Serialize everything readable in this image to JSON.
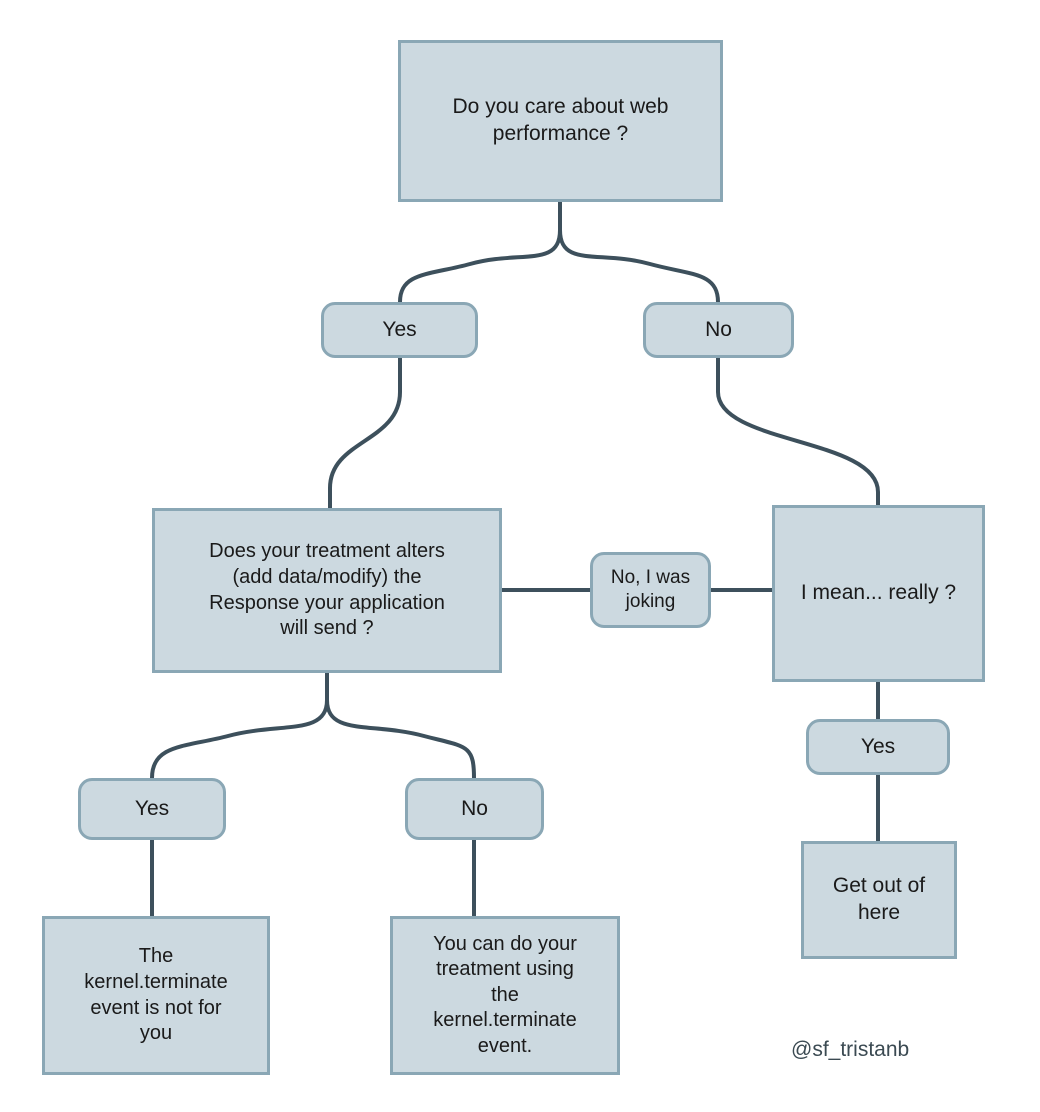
{
  "diagram": {
    "title": "kernel.terminate decision flowchart",
    "background_color": "#ffffff",
    "node_fill_color": "#ccd9e0",
    "node_border_color": "#8aa7b5",
    "edge_color": "#3d505c",
    "text_color": "#1a1a1a"
  },
  "nodes": {
    "root_question": "Do you care about web\nperformance ?",
    "yes_top": "Yes",
    "no_top": "No",
    "treatment_question": "Does your treatment alters\n(add data/modify) the\nResponse your application\nwill send ?",
    "joking": "No, I was\njoking",
    "really": "I mean... really ?",
    "yes_left": "Yes",
    "no_left": "No",
    "yes_right": "Yes",
    "not_for_you": "The\nkernel.terminate\nevent is not for\nyou",
    "can_do": "You can do your\ntreatment using\nthe\nkernel.terminate\nevent.",
    "get_out": "Get out of\nhere"
  },
  "signature": "@sf_tristanb"
}
